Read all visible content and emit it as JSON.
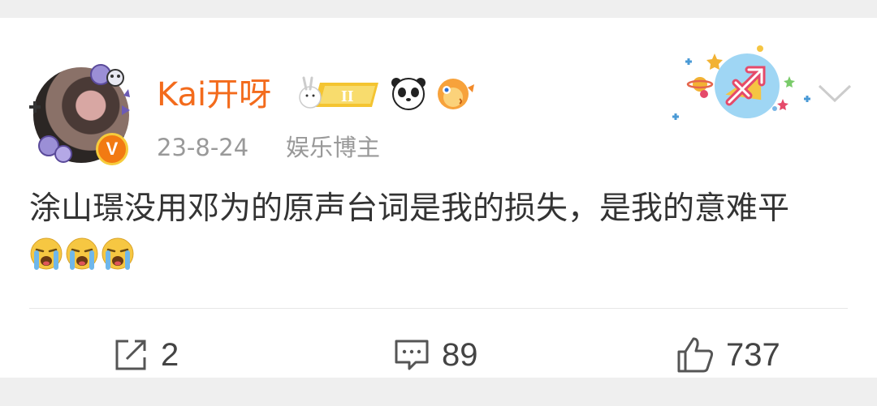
{
  "post": {
    "username": "Kai开呀",
    "time": "23-8-24",
    "source": "娱乐博主",
    "content_text": "涂山璟没用邓为的原声台词是我的损失，是我的意难平"
  },
  "badges": [
    "gemini-level-badge",
    "panda-icon",
    "pufferfish-icon"
  ],
  "sticker": "sagittarius-sticker",
  "actions": {
    "share_count": "2",
    "comment_count": "89",
    "like_count": "737"
  },
  "colors": {
    "username": "#f36b1c",
    "meta": "#999999",
    "text": "#333333",
    "page_bg": "#efefef"
  }
}
